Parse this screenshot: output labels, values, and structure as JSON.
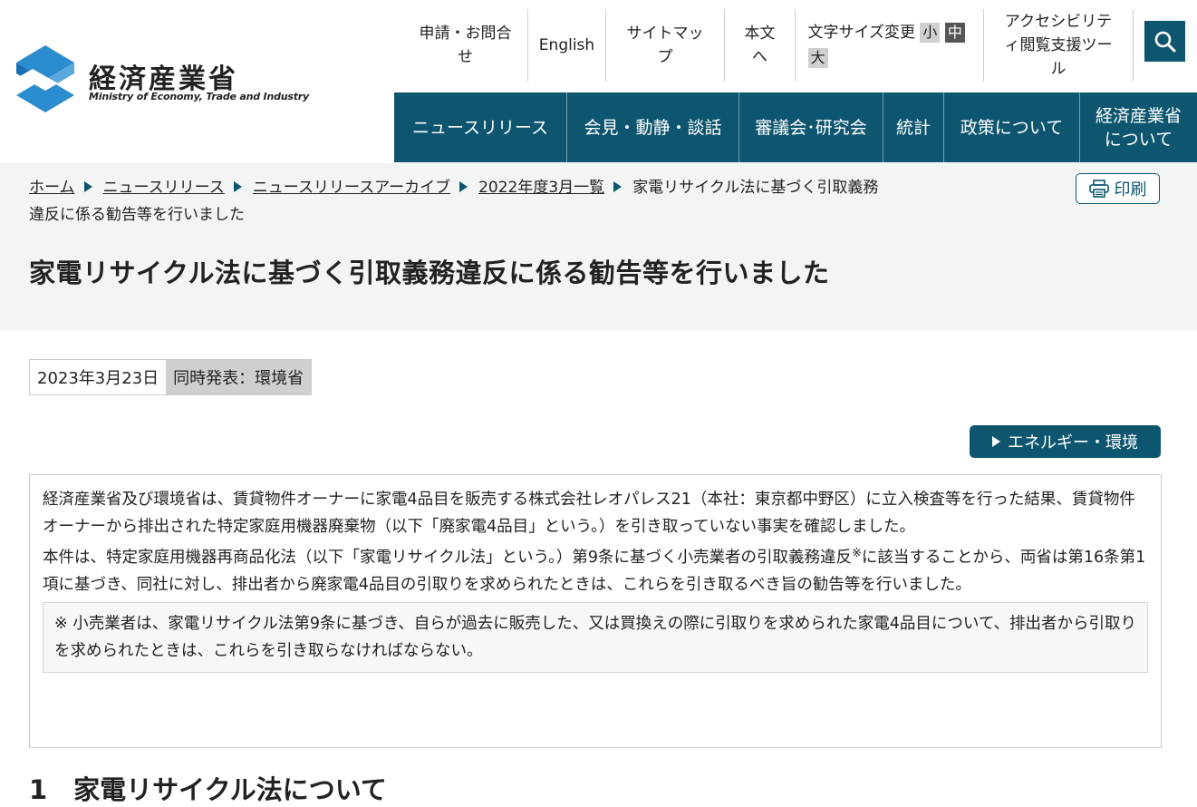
{
  "header": {
    "logo_jp": "経済産業省",
    "logo_en": "Ministry of Economy, Trade and Industry",
    "utility": {
      "contact": "申請・お問合せ",
      "english": "English",
      "sitemap": "サイトマップ",
      "main_text": "本文へ",
      "font_size_label": "文字サイズ変更",
      "font_small": "小",
      "font_mid": "中",
      "font_large": "大",
      "accessibility": "アクセシビリティ閲覧支援ツール"
    },
    "gnav": [
      "ニュースリリース",
      "会見・動静・談話",
      "審議会･研究会",
      "統計",
      "政策について",
      "経済産業省について"
    ]
  },
  "breadcrumb": {
    "home": "ホーム",
    "news": "ニュースリリース",
    "archive": "ニュースリリースアーカイブ",
    "month": "2022年度3月一覧",
    "current": "家電リサイクル法に基づく引取義務違反に係る勧告等を行いました"
  },
  "print_label": "印刷",
  "title": "家電リサイクル法に基づく引取義務違反に係る勧告等を行いました",
  "date": "2023年3月23日",
  "joint": "同時発表：環境省",
  "tag": "エネルギー・環境",
  "summary": {
    "p1": "経済産業省及び環境省は、賃貸物件オーナーに家電4品目を販売する株式会社レオパレス21（本社：東京都中野区）に立入検査等を行った結果、賃貸物件オーナーから排出された特定家庭用機器廃棄物（以下「廃家電4品目」という。）を引き取っていない事実を確認しました。",
    "p2_before": "本件は、特定家庭用機器再商品化法（以下「家電リサイクル法」という。）第9条に基づく小売業者の引取義務違反",
    "p2_mark": "※",
    "p2_after": "に該当することから、両省は第16条第1項に基づき、同社に対し、排出者から廃家電4品目の引取りを求められたときは、これらを引き取るべき旨の勧告等を行いました。",
    "note": "※ 小売業者は、家電リサイクル法第9条に基づき、自らが過去に販売した、又は買換えの際に引取りを求められた家電4品目について、排出者から引取りを求められたときは、これらを引き取らなければならない。"
  },
  "section1": "1　家電リサイクル法について"
}
